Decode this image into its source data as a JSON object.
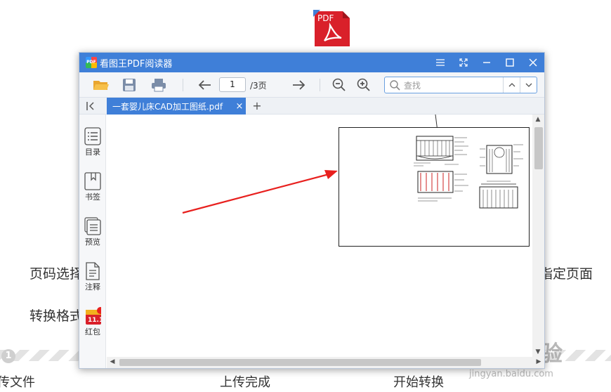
{
  "background": {
    "label_page_range": "页码选择",
    "label_format": "转换格式",
    "label_specific_pages": "指定页面",
    "step_number": "1",
    "steps": [
      "传文件",
      "上传完成",
      "开始转换"
    ],
    "watermark_main": "Bai 经验",
    "watermark_sub": "jingyan.baidu.com",
    "pdf_icon_text": "PDF"
  },
  "window": {
    "title": "看图王PDF阅读器",
    "logo_text": "PDF",
    "controls": [
      "menu-icon",
      "fullscreen-icon",
      "minimize-icon",
      "maximize-icon",
      "close-icon"
    ]
  },
  "toolbar": {
    "page_current": "1",
    "page_total": "/3页",
    "search_placeholder": "查找"
  },
  "tabs": {
    "active_tab": "一套婴儿床CAD加工图纸.pdf",
    "close_symbol": "×",
    "add_symbol": "+"
  },
  "sidebar": {
    "items": [
      {
        "label": "目录",
        "icon": "list-icon"
      },
      {
        "label": "书签",
        "icon": "bookmark-icon"
      },
      {
        "label": "预览",
        "icon": "preview-icon"
      },
      {
        "label": "注释",
        "icon": "annotation-icon"
      },
      {
        "label": "红包",
        "icon": "red-packet-icon",
        "badge": "1"
      }
    ]
  },
  "colors": {
    "accent": "#3f7fd8",
    "arrow": "#e8201e"
  }
}
